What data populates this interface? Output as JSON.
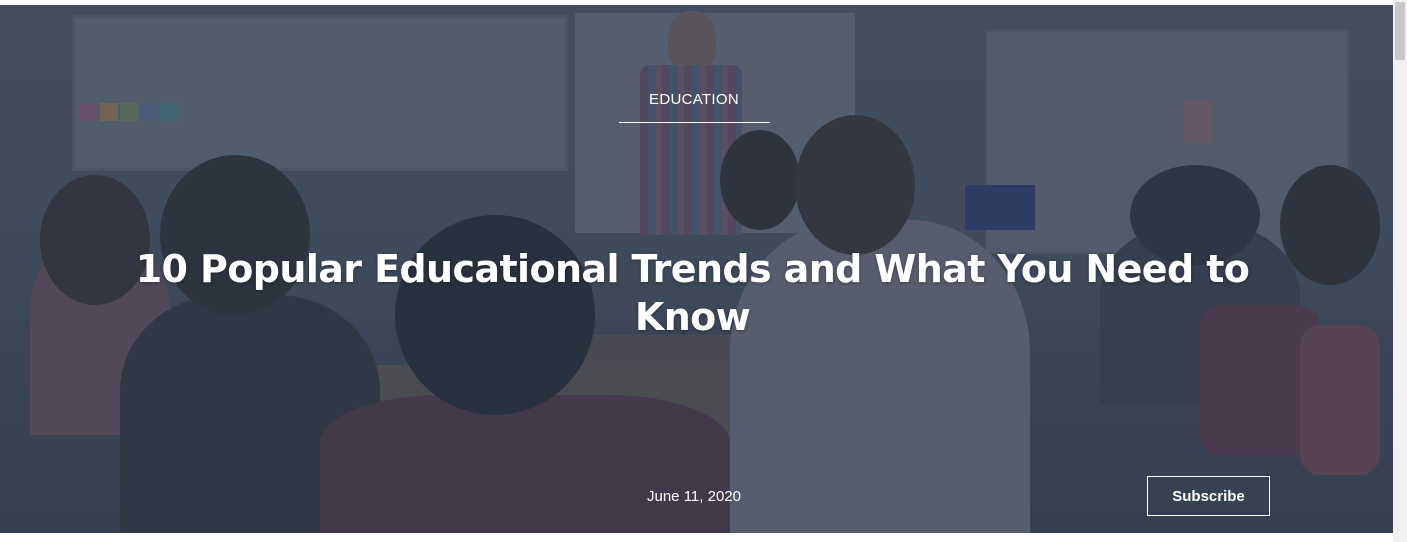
{
  "hero": {
    "category": "EDUCATION",
    "title": "10 Popular Educational Trends and What You Need to Know",
    "date": "June 11, 2020",
    "subscribe_label": "Subscribe",
    "overlay_color": "#303a4e"
  },
  "colors": {
    "text": "#ffffff",
    "button_border": "#ffffff",
    "scrollbar_track": "#f1f1f1",
    "scrollbar_thumb": "#c8c8c8"
  }
}
